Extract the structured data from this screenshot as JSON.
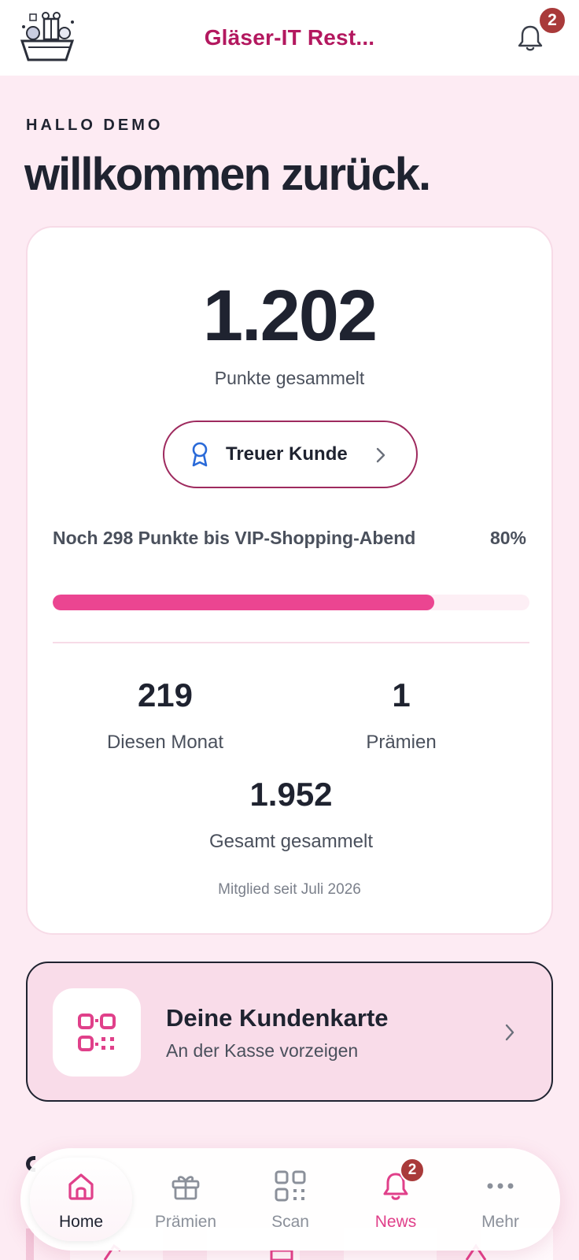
{
  "header": {
    "title": "Gläser-IT Rest...",
    "notification_count": "2"
  },
  "greeting": {
    "hello": "HALLO DEMO",
    "welcome": "willkommen zurück."
  },
  "points_card": {
    "points": "1.202",
    "points_label": "Punkte gesammelt",
    "tier_label": "Treuer Kunde",
    "goal_text": "Noch 298 Punkte bis VIP-Shopping-Abend",
    "goal_percent_label": "80%",
    "goal_progress_fraction": 0.8,
    "stats": {
      "month_value": "219",
      "month_label": "Diesen Monat",
      "rewards_value": "1",
      "rewards_label": "Prämien",
      "total_value": "1.952",
      "total_label": "Gesamt gesammelt"
    },
    "member_since": "Mitglied seit Juli 2026"
  },
  "customer_card": {
    "title": "Deine Kundenkarte",
    "subtitle": "An der Kasse vorzeigen"
  },
  "nav": {
    "home": "Home",
    "rewards": "Prämien",
    "scan": "Scan",
    "news": "News",
    "news_badge": "2",
    "more": "Mehr"
  },
  "colors": {
    "brand": "#b3185f",
    "accent": "#eb4591",
    "background": "#fdebf3",
    "badge": "#a93a3a"
  }
}
